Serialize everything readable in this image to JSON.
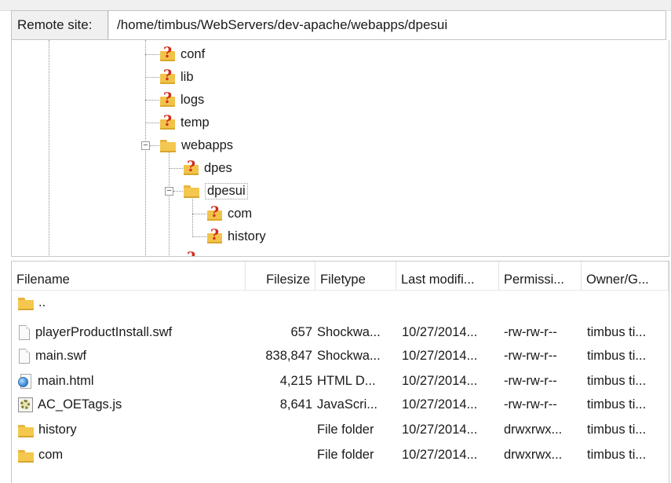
{
  "remote": {
    "label": "Remote site:",
    "path": "/home/timbus/WebServers/dev-apache/webapps/dpesui"
  },
  "tree": {
    "nodes": [
      {
        "label": "conf",
        "icon": "unknown-folder-icon"
      },
      {
        "label": "lib",
        "icon": "unknown-folder-icon"
      },
      {
        "label": "logs",
        "icon": "unknown-folder-icon"
      },
      {
        "label": "temp",
        "icon": "unknown-folder-icon"
      },
      {
        "label": "webapps",
        "icon": "folder-icon",
        "expanded": true
      },
      {
        "label": "dpes",
        "icon": "unknown-folder-icon"
      },
      {
        "label": "dpesui",
        "icon": "folder-icon",
        "expanded": true,
        "selected": true
      },
      {
        "label": "com",
        "icon": "unknown-folder-icon"
      },
      {
        "label": "history",
        "icon": "unknown-folder-icon"
      }
    ]
  },
  "list": {
    "columns": [
      "Filename",
      "Filesize",
      "Filetype",
      "Last modifi...",
      "Permissi...",
      "Owner/G..."
    ],
    "rows": [
      {
        "name": "..",
        "size": "",
        "type": "",
        "date": "",
        "perm": "",
        "owner": "",
        "icon": "folder-icon"
      },
      {
        "name": "playerProductInstall.swf",
        "size": "657",
        "type": "Shockwa...",
        "date": "10/27/2014...",
        "perm": "-rw-rw-r--",
        "owner": "timbus ti...",
        "icon": "file-icon"
      },
      {
        "name": "main.swf",
        "size": "838,847",
        "type": "Shockwa...",
        "date": "10/27/2014...",
        "perm": "-rw-rw-r--",
        "owner": "timbus ti...",
        "icon": "file-icon"
      },
      {
        "name": "main.html",
        "size": "4,215",
        "type": "HTML D...",
        "date": "10/27/2014...",
        "perm": "-rw-rw-r--",
        "owner": "timbus ti...",
        "icon": "html-file-icon"
      },
      {
        "name": "AC_OETags.js",
        "size": "8,641",
        "type": "JavaScri...",
        "date": "10/27/2014...",
        "perm": "-rw-rw-r--",
        "owner": "timbus ti...",
        "icon": "script-file-icon"
      },
      {
        "name": "history",
        "size": "",
        "type": "File folder",
        "date": "10/27/2014...",
        "perm": "drwxrwx...",
        "owner": "timbus ti...",
        "icon": "folder-icon"
      },
      {
        "name": "com",
        "size": "",
        "type": "File folder",
        "date": "10/27/2014...",
        "perm": "drwxrwx...",
        "owner": "timbus ti...",
        "icon": "folder-icon"
      }
    ]
  }
}
